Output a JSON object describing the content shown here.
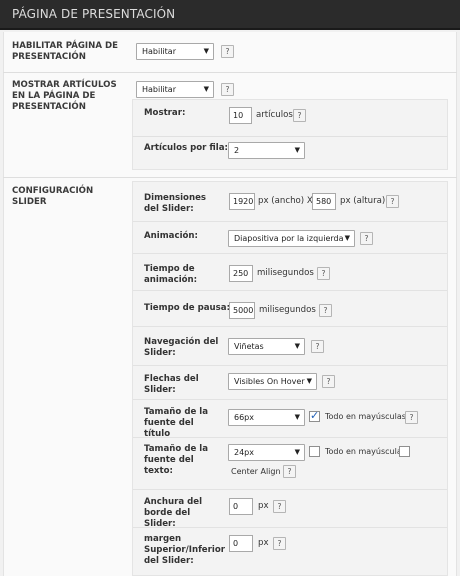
{
  "header": {
    "title": "PÁGINA DE PRESENTACIÓN"
  },
  "sections": {
    "habilitar": {
      "title": "HABILITAR PÁGINA DE PRESENTACIÓN",
      "value": "Habilitar",
      "help": "?"
    },
    "mostrar_articulos": {
      "title": "MOSTRAR ARTÍCULOS EN LA PÁGINA DE PRESENTACIÓN",
      "value": "Habilitar",
      "help": "?",
      "mostrar": {
        "label": "Mostrar:",
        "value": "10",
        "unit": "artículos",
        "help": "?"
      },
      "por_fila": {
        "label": "Artículos por fila:",
        "value": "2"
      }
    },
    "slider": {
      "title": "CONFIGURACIÓN SLIDER",
      "dimensiones": {
        "label": "Dimensiones del Slider:",
        "width": "1920",
        "unit_w": "px (ancho) X",
        "height": "580",
        "unit_h": "px (altura)",
        "help": "?"
      },
      "animacion": {
        "label": "Animación:",
        "value": "Diapositiva por la izquierda",
        "help": "?"
      },
      "tiempo_animacion": {
        "label": "Tiempo de animación:",
        "value": "250",
        "unit": "milisegundos",
        "help": "?"
      },
      "tiempo_pausa": {
        "label": "Tiempo de pausa:",
        "value": "5000",
        "unit": "milisegundos",
        "help": "?"
      },
      "navegacion": {
        "label": "Navegación del Slider:",
        "value": "Viñetas",
        "help": "?"
      },
      "flechas": {
        "label": "Flechas del Slider:",
        "value": "Visibles On Hover",
        "help": "?"
      },
      "tam_titulo": {
        "label": "Tamaño de la fuente del título",
        "value": "66px",
        "checkbox_label": "Todo en mayúsculas",
        "checked": true,
        "help": "?"
      },
      "tam_texto": {
        "label": "Tamaño de la fuente del texto:",
        "value": "24px",
        "checkbox_label": "Todo en mayúsculas",
        "checked": false,
        "center_label": "Center Align",
        "help": "?"
      },
      "anchura_borde": {
        "label": "Anchura del borde del Slider:",
        "value": "0",
        "unit": "px",
        "help": "?"
      },
      "margen": {
        "label": "margen Superior/Inferior del Slider:",
        "value": "0",
        "unit": "px",
        "help": "?"
      }
    }
  },
  "icons": {
    "dropdown": "chevron-down-icon",
    "help": "help-icon",
    "check": "check-icon"
  }
}
